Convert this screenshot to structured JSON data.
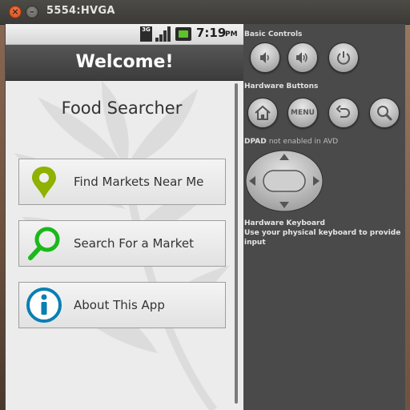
{
  "window": {
    "title": "5554:HVGA",
    "close_glyph": "×",
    "minimize_glyph": "–"
  },
  "status_bar": {
    "network_type": "3G",
    "time": "7:19",
    "ampm": "PM",
    "battery_color": "#5ec22b"
  },
  "action_bar": {
    "title": "Welcome!"
  },
  "main": {
    "app_title": "Food Searcher",
    "buttons": [
      {
        "label": "Find Markets Near Me",
        "icon": "map-pin-icon",
        "icon_color": "#8fb100"
      },
      {
        "label": "Search For a Market",
        "icon": "magnifier-icon",
        "icon_color": "#1bb81b"
      },
      {
        "label": "About This App",
        "icon": "info-icon",
        "icon_color": "#0a7fb3"
      }
    ]
  },
  "controls": {
    "basic_controls_title": "Basic Controls",
    "basic_buttons": [
      "volume-down-icon",
      "volume-up-icon",
      "power-icon"
    ],
    "hardware_buttons_title": "Hardware Buttons",
    "menu_label": "MENU",
    "hardware_buttons": [
      "home-icon",
      "menu-button",
      "back-icon",
      "search-icon"
    ],
    "dpad_title": "DPAD",
    "dpad_note": "not enabled in AVD",
    "keyboard_title": "Hardware Keyboard",
    "keyboard_note": "Use your physical keyboard to provide input"
  }
}
